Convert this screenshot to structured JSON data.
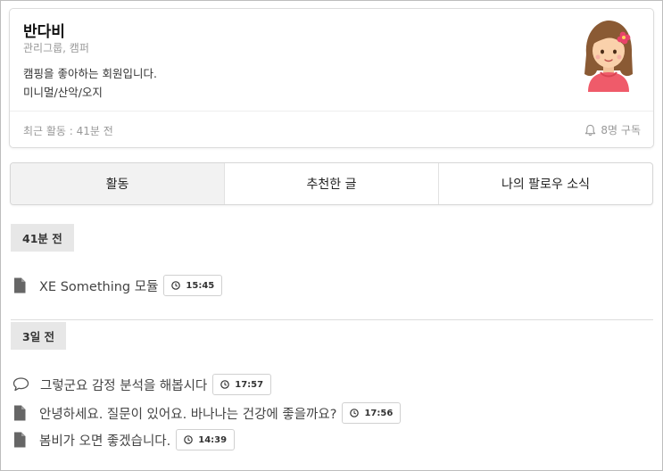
{
  "profile": {
    "name": "반다비",
    "groups": "관리그룹, 캠퍼",
    "bio": "캠핑을 좋아하는 회원입니다.",
    "tags": "미니멀/산악/오지",
    "last_activity": "최근 활동 : 41분 전",
    "subscribers": "8명 구독",
    "avatar_icon": "girl-avatar-icon"
  },
  "tabs": [
    {
      "label": "활동",
      "active": true
    },
    {
      "label": "추천한 글",
      "active": false
    },
    {
      "label": "나의 팔로우 소식",
      "active": false
    }
  ],
  "sections": [
    {
      "label": "41분 전",
      "items": [
        {
          "icon": "document-icon",
          "text": "XE Something 모듈",
          "time": "15:45"
        }
      ]
    },
    {
      "label": "3일 전",
      "items": [
        {
          "icon": "comment-icon",
          "text": "그렇군요 감정 분석을 해봅시다",
          "time": "17:57"
        },
        {
          "icon": "document-icon",
          "text": "안녕하세요. 질문이 있어요. 바나나는 건강에 좋을까요?",
          "time": "17:56"
        },
        {
          "icon": "document-icon",
          "text": "봄비가 오면 좋겠습니다.",
          "time": "14:39"
        }
      ]
    }
  ],
  "colors": {
    "border": "#dcdcdc",
    "tab_active_bg": "#f2f2f2",
    "time_label_bg": "#e7e7e7",
    "muted_text": "#999999"
  }
}
